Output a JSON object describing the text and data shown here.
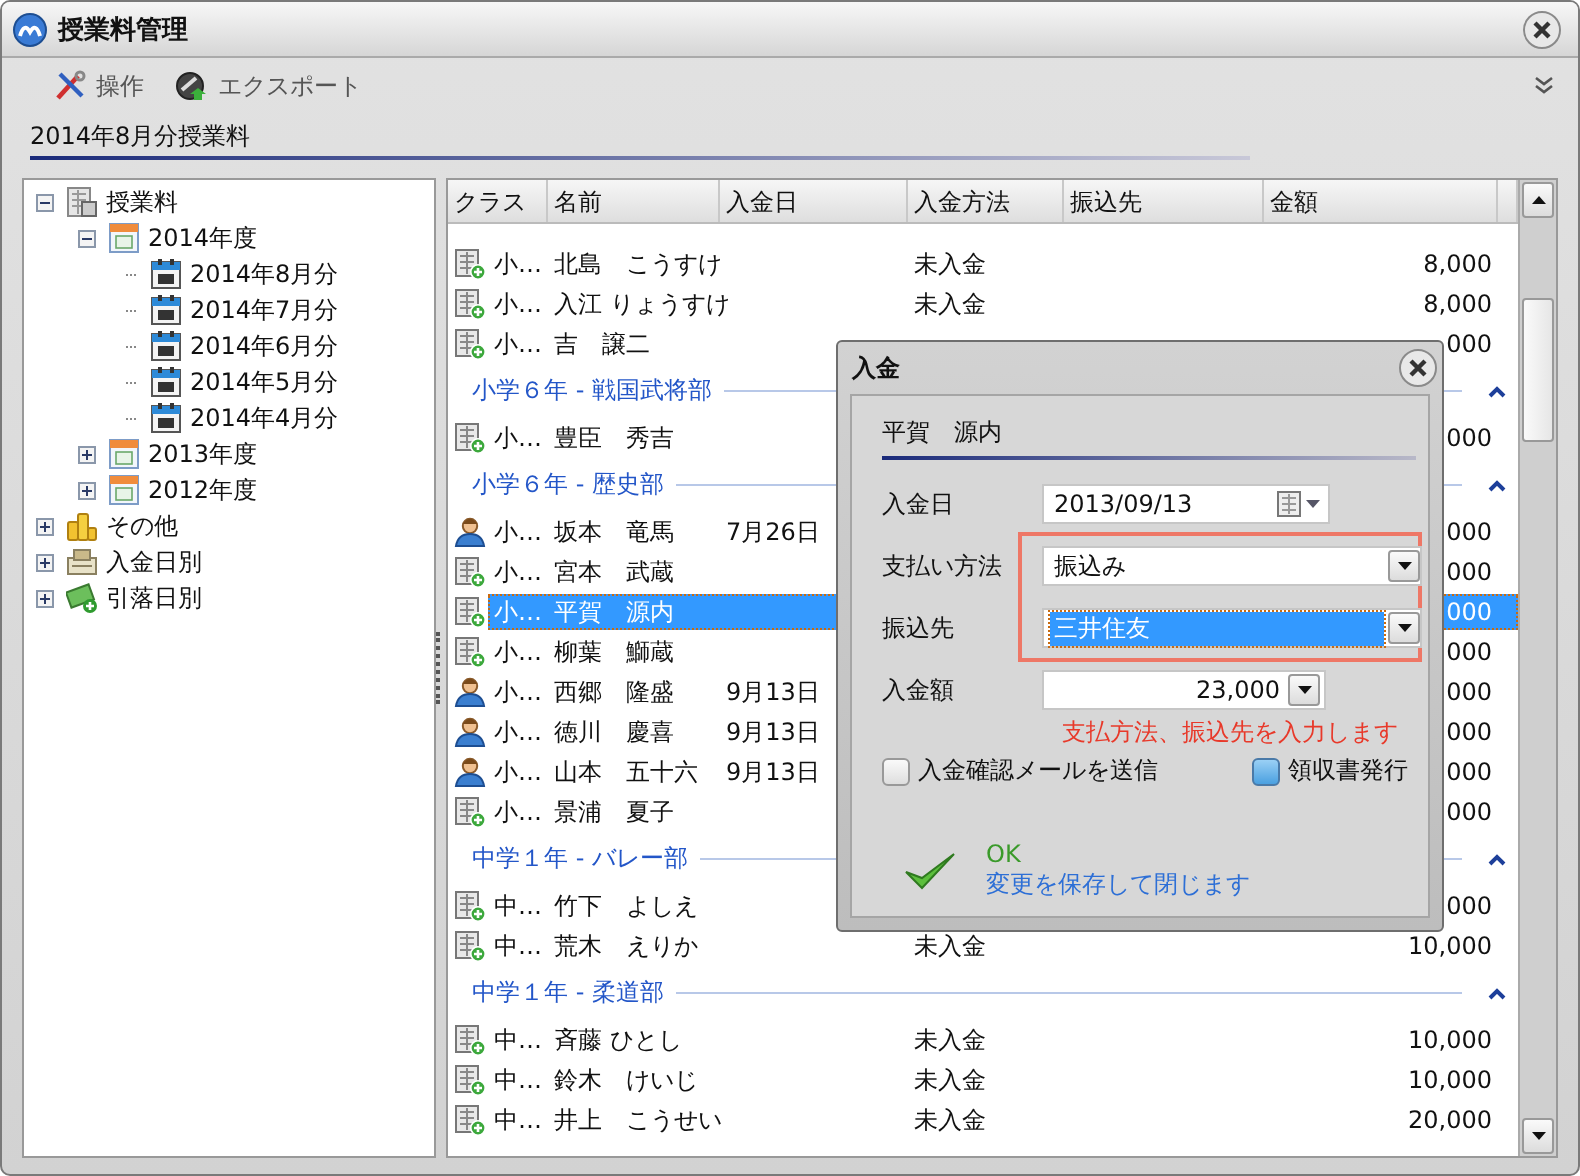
{
  "window": {
    "title": "授業料管理"
  },
  "toolbar": {
    "items": [
      {
        "label": "操作",
        "kind": "tools"
      },
      {
        "label": "エクスポート",
        "kind": "export"
      }
    ]
  },
  "section_title": "2014年8月分授業料",
  "tree": [
    {
      "label": "授業料",
      "kind": "ledger",
      "expanded": true,
      "children": [
        {
          "label": "2014年度",
          "kind": "year",
          "expanded": true,
          "children": [
            {
              "label": "2014年8月分",
              "kind": "month"
            },
            {
              "label": "2014年7月分",
              "kind": "month"
            },
            {
              "label": "2014年6月分",
              "kind": "month"
            },
            {
              "label": "2014年5月分",
              "kind": "month"
            },
            {
              "label": "2014年4月分",
              "kind": "month"
            }
          ]
        },
        {
          "label": "2013年度",
          "kind": "year",
          "expanded": false
        },
        {
          "label": "2012年度",
          "kind": "year",
          "expanded": false
        }
      ]
    },
    {
      "label": "その他",
      "kind": "coins",
      "expanded": false
    },
    {
      "label": "入金日別",
      "kind": "register",
      "expanded": false
    },
    {
      "label": "引落日別",
      "kind": "money",
      "expanded": false
    }
  ],
  "grid": {
    "columns": [
      "クラス",
      "名前",
      "入金日",
      "入金方法",
      "振込先",
      "金額"
    ],
    "rows": [
      {
        "kind": "row",
        "paid": false,
        "selected": false,
        "class": "小…",
        "name": "北島　こうすけ",
        "method": "未入金",
        "amount": "8,000"
      },
      {
        "kind": "row",
        "paid": false,
        "selected": false,
        "class": "小…",
        "name": "入江 りょうすけ",
        "method": "未入金",
        "amount": "8,000"
      },
      {
        "kind": "row",
        "paid": false,
        "selected": false,
        "class": "小…",
        "name": "吉　譲二",
        "amount": "000"
      },
      {
        "kind": "group",
        "label": "小学６年 - 戦国武将部",
        "expanded": true
      },
      {
        "kind": "row",
        "paid": false,
        "selected": false,
        "class": "小…",
        "name": "豊臣　秀吉",
        "amount": "000"
      },
      {
        "kind": "group",
        "label": "小学６年 - 歴史部",
        "expanded": true
      },
      {
        "kind": "row",
        "paid": true,
        "selected": false,
        "class": "小…",
        "name": "坂本　竜馬",
        "date": "7月26日",
        "amount": "000"
      },
      {
        "kind": "row",
        "paid": false,
        "selected": false,
        "class": "小…",
        "name": "宮本　武蔵",
        "amount": "000"
      },
      {
        "kind": "row",
        "paid": false,
        "selected": true,
        "class": "小…",
        "name": "平賀　源内",
        "amount": "000"
      },
      {
        "kind": "row",
        "paid": false,
        "selected": false,
        "class": "小…",
        "name": "柳葉　鰤蔵",
        "amount": "000"
      },
      {
        "kind": "row",
        "paid": true,
        "selected": false,
        "class": "小…",
        "name": "西郷　隆盛",
        "date": "9月13日",
        "amount": "000"
      },
      {
        "kind": "row",
        "paid": true,
        "selected": false,
        "class": "小…",
        "name": "徳川　慶喜",
        "date": "9月13日",
        "amount": "000"
      },
      {
        "kind": "row",
        "paid": true,
        "selected": false,
        "class": "小…",
        "name": "山本　五十六",
        "date": "9月13日",
        "amount": "000"
      },
      {
        "kind": "row",
        "paid": false,
        "selected": false,
        "class": "小…",
        "name": "景浦　夏子",
        "amount": "000"
      },
      {
        "kind": "group",
        "label": "中学１年 - バレー部",
        "expanded": true
      },
      {
        "kind": "row",
        "paid": false,
        "selected": false,
        "class": "中…",
        "name": "竹下　よしえ",
        "amount": "000"
      },
      {
        "kind": "row",
        "paid": false,
        "selected": false,
        "class": "中…",
        "name": "荒木　えりか",
        "method": "未入金",
        "amount": "10,000"
      },
      {
        "kind": "group",
        "label": "中学１年 - 柔道部",
        "expanded": true
      },
      {
        "kind": "row",
        "paid": false,
        "selected": false,
        "class": "中…",
        "name": "斉藤 ひとし",
        "method": "未入金",
        "amount": "10,000"
      },
      {
        "kind": "row",
        "paid": false,
        "selected": false,
        "class": "中…",
        "name": "鈴木　けいじ",
        "method": "未入金",
        "amount": "10,000"
      },
      {
        "kind": "row",
        "paid": false,
        "selected": false,
        "class": "中…",
        "name": "井上　こうせい",
        "method": "未入金",
        "amount": "20,000"
      }
    ]
  },
  "dialog": {
    "title": "入金",
    "person": "平賀　源内",
    "fields": [
      {
        "label": "入金日",
        "kind": "date",
        "value": "2013/09/13",
        "focused": false,
        "highlighted": false
      },
      {
        "label": "支払い方法",
        "kind": "combo",
        "value": "振込み",
        "focused": false,
        "highlighted": true
      },
      {
        "label": "振込先",
        "kind": "combo",
        "value": "三井住友",
        "focused": true,
        "highlighted": true
      },
      {
        "label": "入金額",
        "kind": "amount",
        "value": "23,000",
        "focused": false,
        "highlighted": false
      }
    ],
    "note": "支払方法、振込先を入力します",
    "checkboxes": [
      {
        "label": "入金確認メールを送信",
        "checked": false
      },
      {
        "label": "領収書発行",
        "checked": true
      }
    ],
    "ok": {
      "title": "OK",
      "description": "変更を保存して閉じます"
    }
  }
}
